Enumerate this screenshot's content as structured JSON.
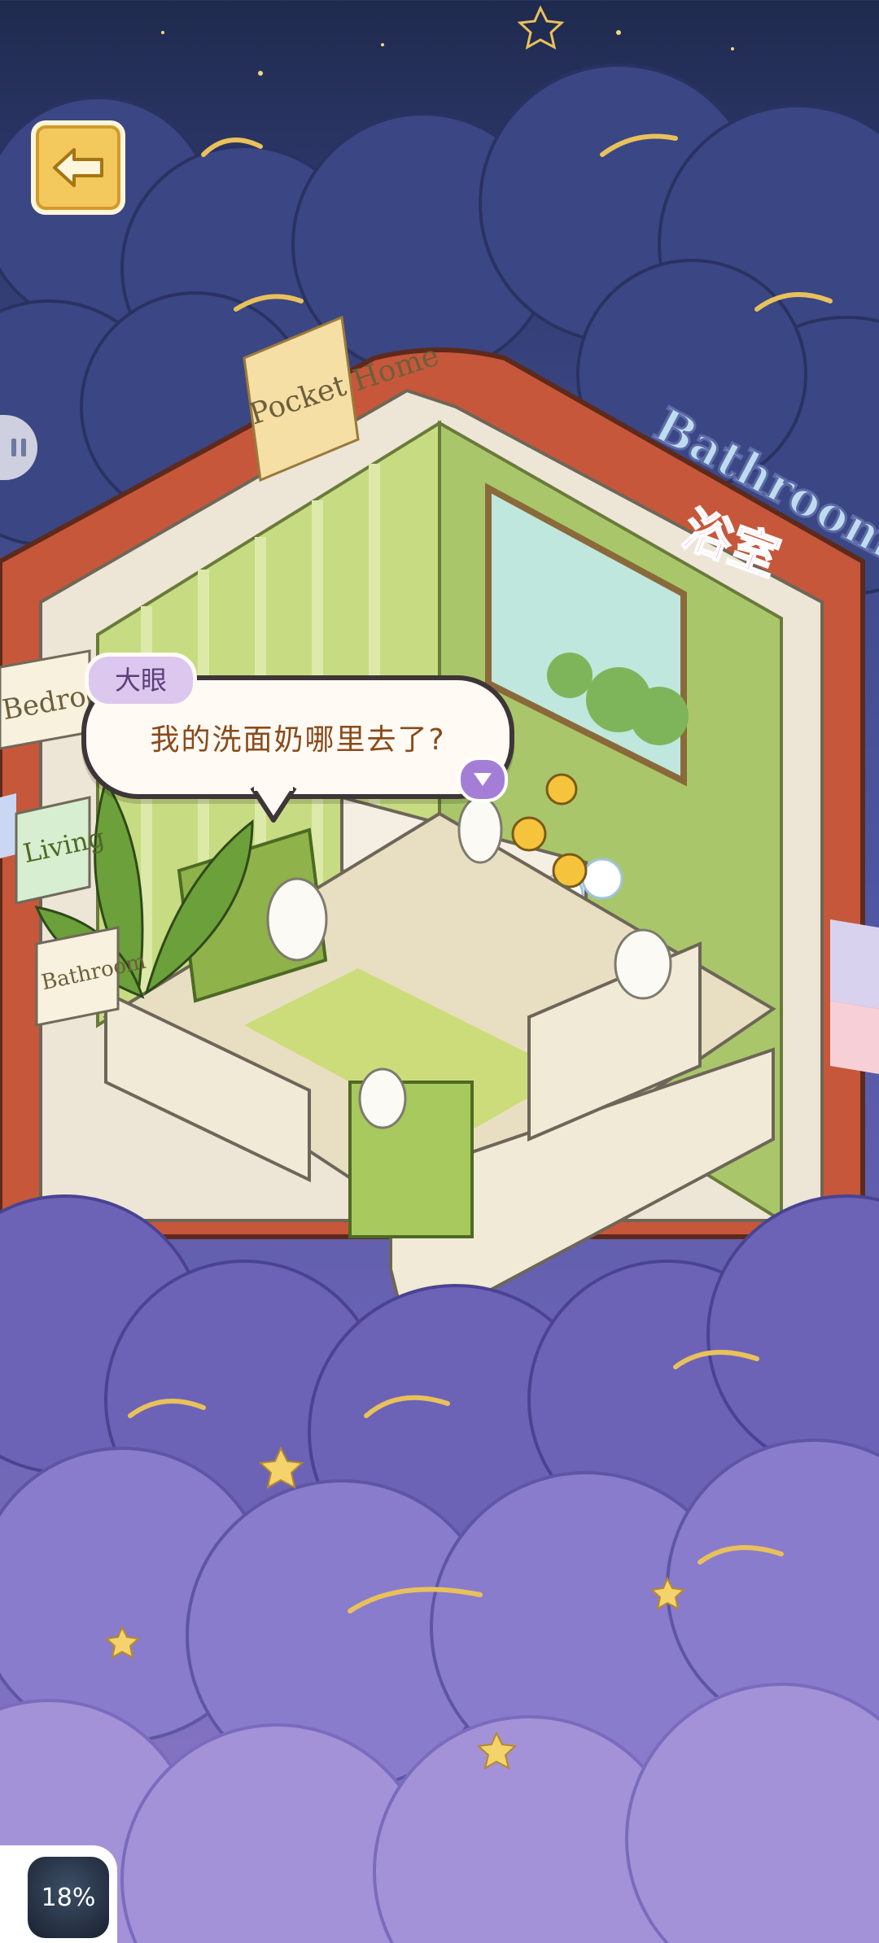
{
  "colors": {
    "sky_top": "#1f2a4e",
    "cloud_dark": "#3b4684",
    "cloud_light": "#9a86d0",
    "book_red": "#c7573a",
    "accent_gold": "#f3c85c",
    "wall_green": "#c7dc82",
    "speech_text": "#8a4a1a",
    "bathroom_pink": "#f4a1c1"
  },
  "top_bar": {
    "back_icon": "arrow-left-icon"
  },
  "room": {
    "sign_pocket_home": "Pocket Home",
    "sign_bathroom_en": "Bathroom",
    "sign_bathroom_cn": "浴室"
  },
  "room_tabs": [
    {
      "label": "Bedroom"
    },
    {
      "label": "Living"
    },
    {
      "label": "Bathroom"
    }
  ],
  "dialog": {
    "speaker": "大眼",
    "text": "我的洗面奶哪里去了?",
    "next_icon": "triangle-down-icon"
  },
  "progress": {
    "value_text": "18%",
    "value": 18
  }
}
